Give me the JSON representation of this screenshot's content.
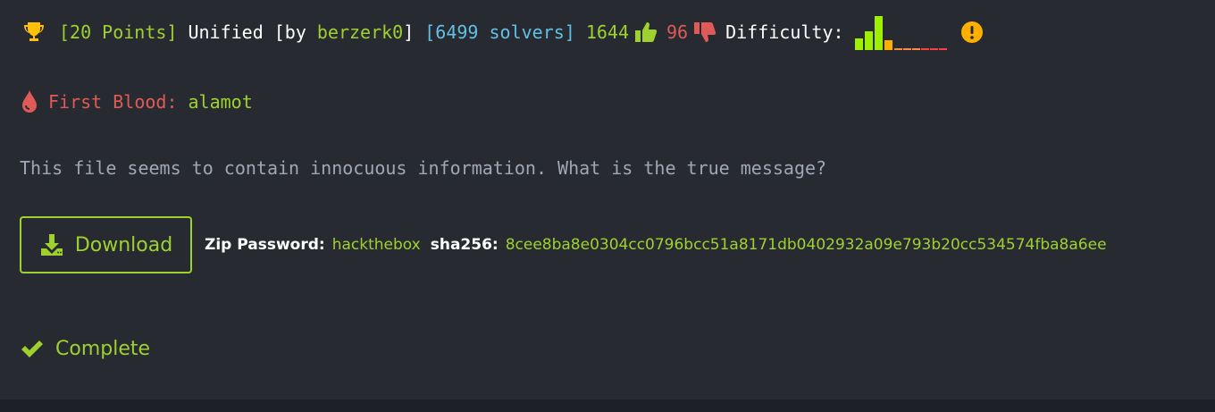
{
  "header": {
    "points_label": "[20 Points]",
    "challenge_name": "Unified",
    "by_prefix": "[by",
    "author": "berzerk0",
    "by_suffix": "]",
    "solvers_label": "[6499 solvers]",
    "likes": "1644",
    "dislikes": "96",
    "difficulty_label": "Difficulty:",
    "difficulty_bars": [
      {
        "level": 0.35,
        "color": "#9fef00"
      },
      {
        "level": 0.55,
        "color": "#9fef00"
      },
      {
        "level": 1.0,
        "color": "#9fef00"
      },
      {
        "level": 0.3,
        "color": "#ffaf00"
      },
      {
        "level": 0.05,
        "color": "#ff8c3a"
      },
      {
        "level": 0.05,
        "color": "#ff8c3a"
      },
      {
        "level": 0.05,
        "color": "#ff8c3a"
      },
      {
        "level": 0.05,
        "color": "#ff3e3e"
      },
      {
        "level": 0.05,
        "color": "#ff3e3e"
      },
      {
        "level": 0.05,
        "color": "#ff3e3e"
      }
    ],
    "icons": {
      "trophy": "trophy-icon",
      "like": "thumbs-up-icon",
      "dislike": "thumbs-down-icon",
      "warning": "exclamation-circle-icon"
    }
  },
  "first_blood": {
    "label": "First Blood:",
    "user": "alamot",
    "icon": "blood-drop-icon"
  },
  "description": "This file seems to contain innocuous information. What is the true message?",
  "download": {
    "button_label": "Download",
    "icon": "download-icon",
    "zip_password_label": "Zip Password:",
    "zip_password": "hackthebox",
    "sha_label": "sha256:",
    "sha_value": "8cee8ba8e0304cc0796bcc51a8171db0402932a09e793b20cc534574fba8a6ee"
  },
  "status": {
    "label": "Complete",
    "icon": "check-icon"
  },
  "colors": {
    "background": "#272b31",
    "accent_green": "#9fd12e",
    "blue": "#62c0e6",
    "red": "#e05a57",
    "trophy": "#ffc107"
  }
}
